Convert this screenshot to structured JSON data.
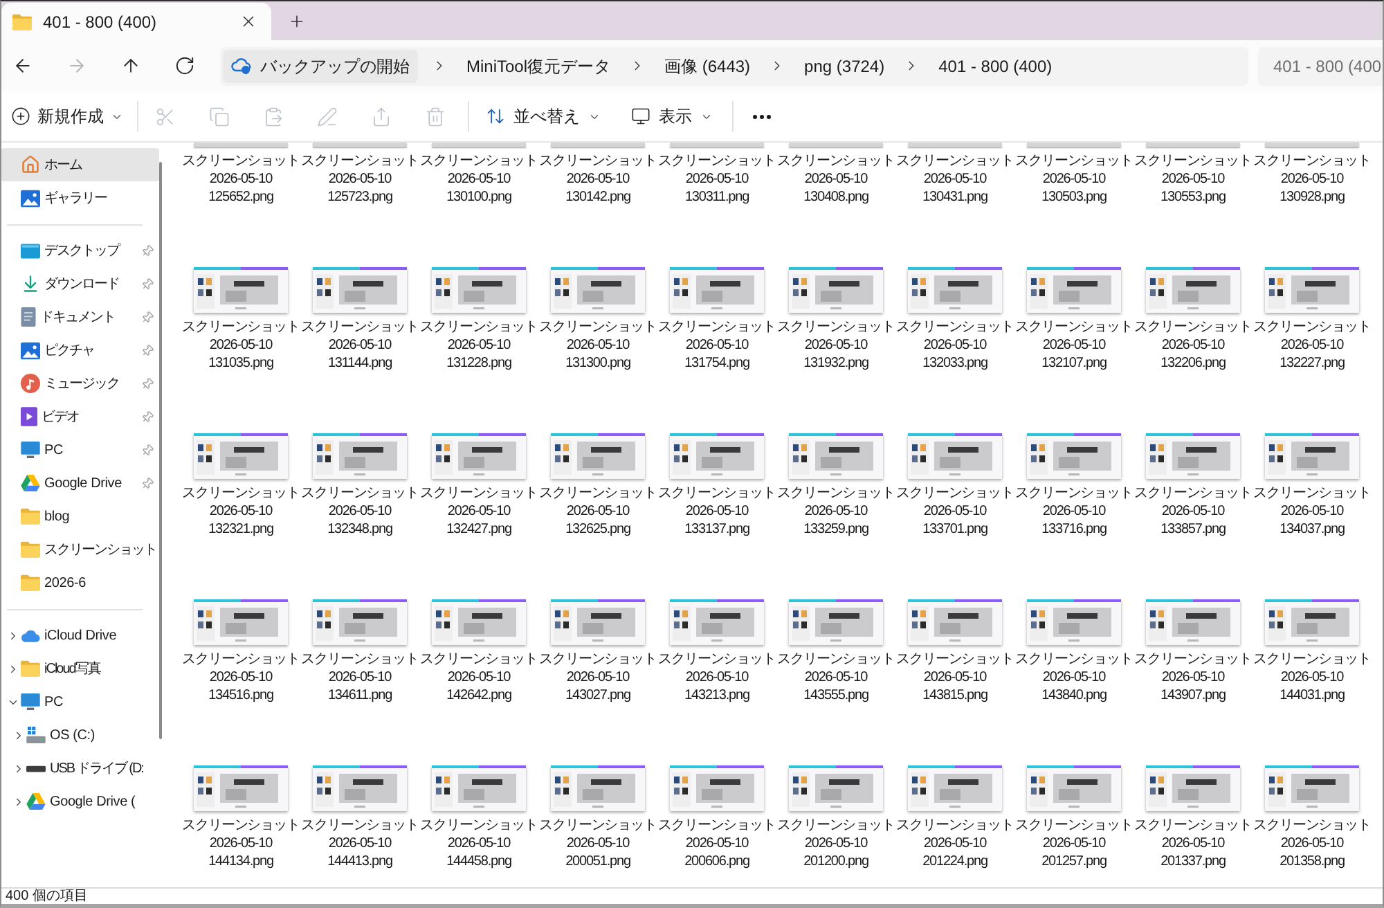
{
  "tabs": [
    {
      "title": "401 - 800 (400)",
      "selected": true
    }
  ],
  "nav_buttons": [
    {
      "disabled": false
    },
    {
      "disabled": true
    },
    {
      "disabled": false
    },
    {
      "disabled": false
    }
  ],
  "address_bar": {
    "breadcrumbs": [
      {
        "kind": "backup",
        "label": "バックアップの開始"
      },
      {
        "kind": "folder",
        "label": "MiniTool復元データ"
      },
      {
        "kind": "folder",
        "label": "画像 (6443)"
      },
      {
        "kind": "folder",
        "label": "png (3724)"
      },
      {
        "kind": "folder",
        "label": "401 - 800 (400)"
      }
    ]
  },
  "search": {
    "placeholder": "401 - 800 (400"
  },
  "toolbar": {
    "new_label": "新規作成",
    "icon_buttons": [
      {
        "disabled": true
      },
      {
        "disabled": true
      },
      {
        "disabled": true
      },
      {
        "disabled": true
      },
      {
        "disabled": true
      },
      {
        "disabled": true
      }
    ],
    "sort_label": "並べ替え",
    "view_label": "表示"
  },
  "sidebar": {
    "groups": [
      {
        "items": [
          {
            "label": "ホーム",
            "selected": true
          },
          {
            "label": "ギャラリー",
            "selected": false
          }
        ]
      },
      {
        "items": [
          {
            "label": "デスクトップ",
            "selected": false,
            "pinned": true
          },
          {
            "label": "ダウンロード",
            "selected": false,
            "pinned": true
          },
          {
            "label": "ドキュメント",
            "selected": false,
            "pinned": true
          },
          {
            "label": "ピクチャ",
            "selected": false,
            "pinned": true
          },
          {
            "label": "ミュージック",
            "selected": false,
            "pinned": true
          },
          {
            "label": "ビデオ",
            "selected": false,
            "pinned": true
          },
          {
            "label": "PC",
            "selected": false,
            "pinned": true
          },
          {
            "label": "Google Drive",
            "selected": false,
            "pinned": true
          },
          {
            "label": "blog",
            "selected": false,
            "pinned": false
          },
          {
            "label": "スクリーンショット",
            "selected": false,
            "pinned": false
          },
          {
            "label": "2026-6",
            "selected": false,
            "pinned": false
          }
        ]
      },
      {
        "items": [
          {
            "label": "iCloud Drive",
            "selected": false,
            "expanded": false
          },
          {
            "label": "iCloud写真",
            "selected": false,
            "expanded": false
          },
          {
            "label": "PC",
            "selected": false,
            "expanded": true,
            "children": [
              {
                "label": "OS (C:)",
                "selected": false,
                "expanded": false
              },
              {
                "label": "USB ドライブ (D:",
                "selected": false,
                "expanded": false
              },
              {
                "label": "Google Drive (",
                "selected": false,
                "expanded": false
              }
            ]
          }
        ]
      }
    ]
  },
  "files": [
    {
      "name": "スクリーンショット 2026-05-10 125652.png"
    },
    {
      "name": "スクリーンショット 2026-05-10 125723.png"
    },
    {
      "name": "スクリーンショット 2026-05-10 130100.png"
    },
    {
      "name": "スクリーンショット 2026-05-10 130142.png"
    },
    {
      "name": "スクリーンショット 2026-05-10 130311.png"
    },
    {
      "name": "スクリーンショット 2026-05-10 130408.png"
    },
    {
      "name": "スクリーンショット 2026-05-10 130431.png"
    },
    {
      "name": "スクリーンショット 2026-05-10 130503.png"
    },
    {
      "name": "スクリーンショット 2026-05-10 130553.png"
    },
    {
      "name": "スクリーンショット 2026-05-10 130928.png"
    },
    {
      "name": "スクリーンショット 2026-05-10 131035.png"
    },
    {
      "name": "スクリーンショット 2026-05-10 131144.png"
    },
    {
      "name": "スクリーンショット 2026-05-10 131228.png"
    },
    {
      "name": "スクリーンショット 2026-05-10 131300.png"
    },
    {
      "name": "スクリーンショット 2026-05-10 131754.png"
    },
    {
      "name": "スクリーンショット 2026-05-10 131932.png"
    },
    {
      "name": "スクリーンショット 2026-05-10 132033.png"
    },
    {
      "name": "スクリーンショット 2026-05-10 132107.png"
    },
    {
      "name": "スクリーンショット 2026-05-10 132206.png"
    },
    {
      "name": "スクリーンショット 2026-05-10 132227.png"
    },
    {
      "name": "スクリーンショット 2026-05-10 132321.png"
    },
    {
      "name": "スクリーンショット 2026-05-10 132348.png"
    },
    {
      "name": "スクリーンショット 2026-05-10 132427.png"
    },
    {
      "name": "スクリーンショット 2026-05-10 132625.png"
    },
    {
      "name": "スクリーンショット 2026-05-10 133137.png"
    },
    {
      "name": "スクリーンショット 2026-05-10 133259.png"
    },
    {
      "name": "スクリーンショット 2026-05-10 133701.png"
    },
    {
      "name": "スクリーンショット 2026-05-10 133716.png"
    },
    {
      "name": "スクリーンショット 2026-05-10 133857.png"
    },
    {
      "name": "スクリーンショット 2026-05-10 134037.png"
    },
    {
      "name": "スクリーンショット 2026-05-10 134516.png"
    },
    {
      "name": "スクリーンショット 2026-05-10 134611.png"
    },
    {
      "name": "スクリーンショット 2026-05-10 142642.png"
    },
    {
      "name": "スクリーンショット 2026-05-10 143027.png"
    },
    {
      "name": "スクリーンショット 2026-05-10 143213.png"
    },
    {
      "name": "スクリーンショット 2026-05-10 143555.png"
    },
    {
      "name": "スクリーンショット 2026-05-10 143815.png"
    },
    {
      "name": "スクリーンショット 2026-05-10 143840.png"
    },
    {
      "name": "スクリーンショット 2026-05-10 143907.png"
    },
    {
      "name": "スクリーンショット 2026-05-10 144031.png"
    },
    {
      "name": "スクリーンショット 2026-05-10 144134.png"
    },
    {
      "name": "スクリーンショット 2026-05-10 144413.png"
    },
    {
      "name": "スクリーンショット 2026-05-10 144458.png"
    },
    {
      "name": "スクリーンショット 2026-05-10 200051.png"
    },
    {
      "name": "スクリーンショット 2026-05-10 200606.png"
    },
    {
      "name": "スクリーンショット 2026-05-10 201200.png"
    },
    {
      "name": "スクリーンショット 2026-05-10 201224.png"
    },
    {
      "name": "スクリーンショット 2026-05-10 201257.png"
    },
    {
      "name": "スクリーンショット 2026-05-10 201337.png"
    },
    {
      "name": "スクリーンショット 2026-05-10 201358.png"
    }
  ],
  "status_bar": {
    "item_count": "400 個の項目"
  }
}
